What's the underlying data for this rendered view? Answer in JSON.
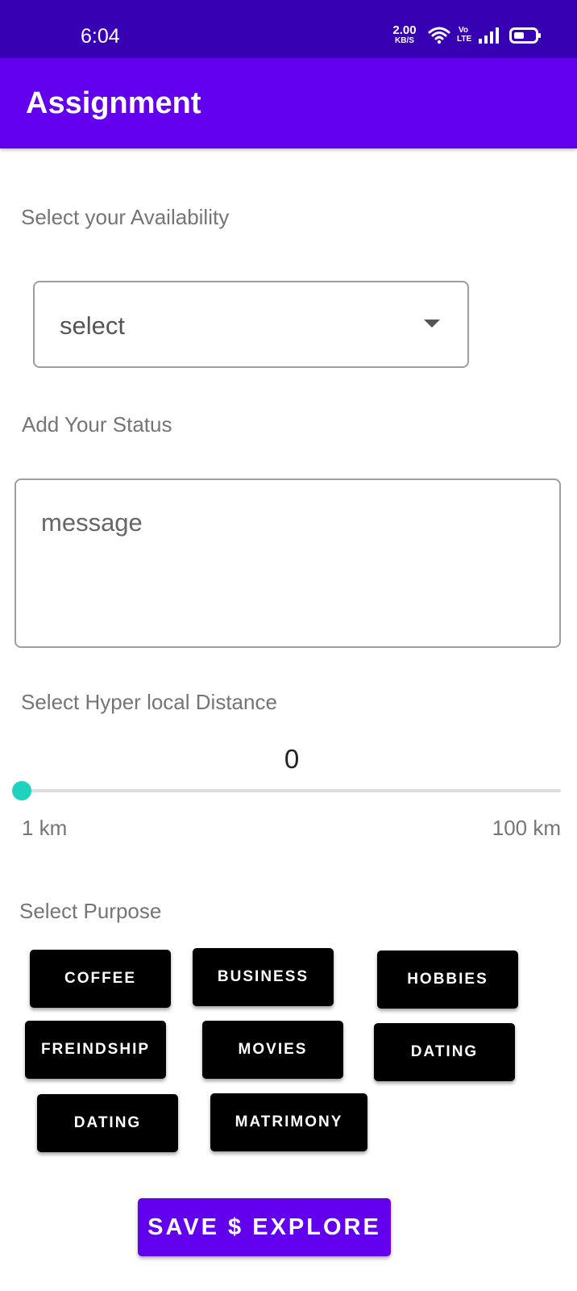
{
  "status_bar": {
    "time": "6:04",
    "speed_value": "2.00",
    "speed_unit": "KB/S",
    "volte_top": "Vo",
    "volte_bottom": "LTE"
  },
  "app_bar": {
    "title": "Assignment"
  },
  "availability": {
    "label": "Select your Availability",
    "selected_value": "select"
  },
  "status": {
    "label": "Add Your Status",
    "placeholder": "message",
    "value": ""
  },
  "distance": {
    "label": "Select Hyper local Distance",
    "current_value": "0",
    "min_label": "1 km",
    "max_label": "100 km",
    "slider_fraction": 0
  },
  "purpose": {
    "label": "Select Purpose",
    "chips": [
      "COFFEE",
      "BUSINESS",
      "HOBBIES",
      "FREINDSHIP",
      "MOVIES",
      "DATING",
      "DATING",
      "MATRIMONY"
    ]
  },
  "save_button_label": "SAVE $ EXPLORE",
  "colors": {
    "status_bar": "#3700b3",
    "app_bar": "#6200ee",
    "slider_thumb": "#1ed3be",
    "chip": "#000000",
    "save_button": "#6200ee"
  }
}
